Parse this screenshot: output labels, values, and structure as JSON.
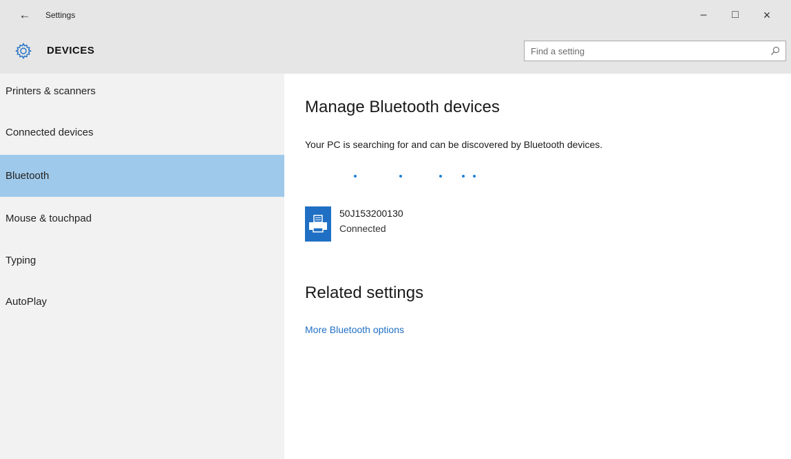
{
  "window": {
    "title": "Settings",
    "back_icon": "←",
    "minimize_icon": "–",
    "maximize_icon": "□",
    "close_icon": "×"
  },
  "header": {
    "section_title": "DEVICES",
    "section_icon": "gear-icon",
    "search_placeholder": "Find a setting",
    "search_icon": "search-icon"
  },
  "sidebar": {
    "items": [
      {
        "label": "Printers & scanners",
        "selected": false
      },
      {
        "label": "Connected devices",
        "selected": false
      },
      {
        "label": "Bluetooth",
        "selected": true
      },
      {
        "label": "Mouse & touchpad",
        "selected": false
      },
      {
        "label": "Typing",
        "selected": false
      },
      {
        "label": "AutoPlay",
        "selected": false
      }
    ],
    "selected_color": "#9fc9ea"
  },
  "main": {
    "heading": "Manage Bluetooth devices",
    "status_text": "Your PC is searching for and can be discovered by Bluetooth devices.",
    "devices": [
      {
        "name": "50J153200130",
        "status": "Connected",
        "icon": "printer-icon"
      }
    ],
    "related_heading": "Related settings",
    "related_links": [
      {
        "label": "More Bluetooth options"
      }
    ]
  },
  "colors": {
    "accent": "#1f6fc4",
    "titlebar_bg": "#e6e6e6",
    "sidebar_bg": "#f2f2f2",
    "progress_dots": "#1e7fd6"
  }
}
